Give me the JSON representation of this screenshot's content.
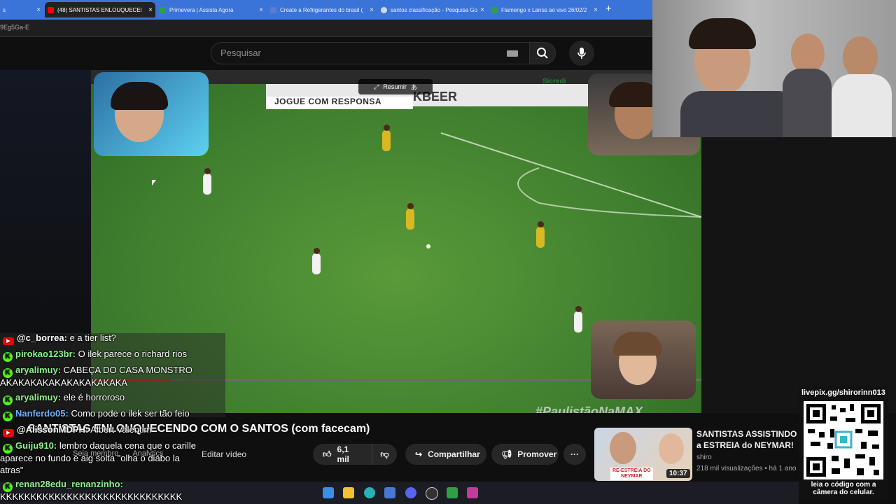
{
  "browser": {
    "tabs": [
      {
        "label": "s",
        "icon_color": "#888888",
        "active": false
      },
      {
        "label": "(48) SANTISTAS ENLOUQUECENDO",
        "icon_color": "#ff0000",
        "active": true
      },
      {
        "label": "Primevera | Assista Agora",
        "icon_color": "#2ea043",
        "active": false
      },
      {
        "label": "Create a Refrigerantes do brasil (",
        "icon_color": "#5b7bd5",
        "active": false
      },
      {
        "label": "santos classificação - Pesquisa Go",
        "icon_color": "#cfd8ea",
        "active": false
      },
      {
        "label": "Flamengo x Lanús ao vivo 26/02/2",
        "icon_color": "#2ea043",
        "active": false
      }
    ],
    "close_glyph": "×",
    "new_tab_glyph": "+",
    "url_fragment": "9Eg5Ga-E"
  },
  "youtube": {
    "search_placeholder": "Pesquisar",
    "video": {
      "summary_button": "Resumir",
      "board_text": "JOGUE COM RESPONSA",
      "board_brand": "KBEER",
      "board_sponsor": "Sicredi",
      "watermark": "#PaulistãoNaMAX",
      "progress_fraction": 0.13
    },
    "title": "SANTISTAS ENLOUQUECENDO COM O SANTOS (com facecam)",
    "studio_links": [
      "Seja membro",
      "Analytics"
    ],
    "edit_video": "Editar vídeo",
    "likes": "6,1 mil",
    "share": "Compartilhar",
    "promote": "Promover",
    "more": "···",
    "recommended": {
      "title": "SANTISTAS ASSISTINDO a ESTREIA do NEYMAR!",
      "channel": "shiro",
      "meta": "218 mil visualizações • há 1 ano",
      "duration": "10:37",
      "thumb_tag_line1": "RE-ESTREIA DO",
      "thumb_tag_line2": "NEYMAR"
    }
  },
  "chat": [
    {
      "platform": "yt",
      "user": "@c_borrea:",
      "message": "e a tier list?",
      "user_color": "#ffffff"
    },
    {
      "platform": "kick",
      "user": "pirokao123br:",
      "message": "O ilek parece o richard rios",
      "user_color": "#8cf58c"
    },
    {
      "platform": "kick",
      "user": "aryalimuy:",
      "message": "CABEÇA DO CASA MONSTRO",
      "message_cont": "AKAKAKAKAKAKAKAKAKAKA",
      "user_color": "#8cf58c"
    },
    {
      "platform": "kick",
      "user": "aryalimuy:",
      "message": "ele é horroroso",
      "user_color": "#8cf58c"
    },
    {
      "platform": "kick",
      "user": "Nanferdo05:",
      "message": "Como pode o ilek ser tão feio",
      "user_color": "#6ab0ff"
    },
    {
      "platform": "yt",
      "user": "@AlissonMDPH:",
      "message": "Albert Valentim",
      "user_color": "#ffffff"
    },
    {
      "platform": "kick",
      "user": "Guiju910:",
      "message": "lembro daquela cena que o carille",
      "message_cont": "aparece no fundo e aig solta \"olha o diabo la",
      "message_cont2": "atras\"",
      "user_color": "#8cf58c"
    },
    {
      "platform": "kick",
      "user": "renan28edu_renanzinho:",
      "message": "",
      "message_cont": "KKKKKKKKKKKKKKKKKKKKKKKKKKKKKK",
      "user_color": "#8cf58c"
    }
  ],
  "qr": {
    "url": "livepix.gg/shirorinn013",
    "caption_line1": "leia o código com a",
    "caption_line2": "câmera do celular."
  },
  "taskbar_icons": [
    "windows-icon",
    "file-explorer-icon",
    "edge-icon",
    "store-icon",
    "discord-icon",
    "obs-icon",
    "app-icon",
    "app2-icon"
  ],
  "colors": {
    "accent_red": "#ff0000",
    "kick_green": "#53fc18",
    "tabbar_blue": "#3b74d9"
  }
}
